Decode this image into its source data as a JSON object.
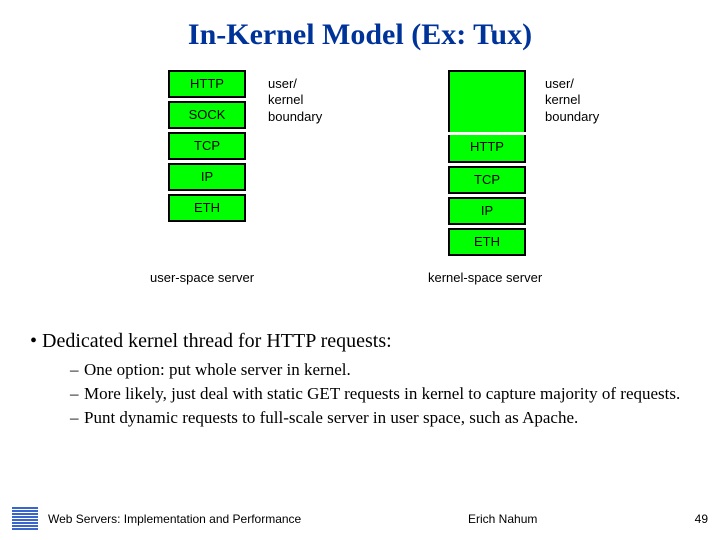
{
  "title": "In-Kernel Model (Ex: Tux)",
  "diagram": {
    "left_stack": {
      "layers": [
        "HTTP",
        "SOCK",
        "TCP",
        "IP",
        "ETH"
      ],
      "boundary_label": "user/\nkernel\nboundary",
      "caption": "user-space server"
    },
    "right_stack": {
      "layers": [
        "HTTP",
        "TCP",
        "IP",
        "ETH"
      ],
      "boundary_label": "user/\nkernel\nboundary",
      "caption": "kernel-space server"
    }
  },
  "bullets": {
    "lead": "Dedicated kernel thread for HTTP requests:",
    "subs": [
      "One option: put whole server in kernel.",
      "More likely, just deal with static GET requests in kernel to capture majority of requests.",
      "Punt dynamic requests to full-scale server in user space, such as Apache."
    ]
  },
  "footer": {
    "left": "Web Servers: Implementation and Performance",
    "mid": "Erich Nahum",
    "page": "49"
  }
}
